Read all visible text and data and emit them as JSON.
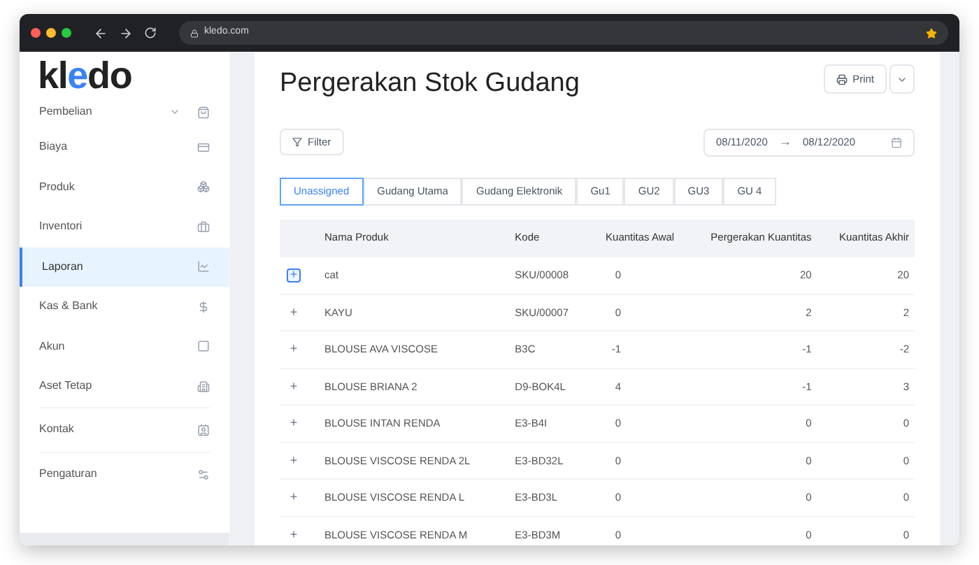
{
  "browser": {
    "url": "kledo.com"
  },
  "sidebar": {
    "logo": "kledo",
    "sections": [
      {
        "items": [
          {
            "label": "Pembelian",
            "selected": false,
            "expandable": true
          },
          {
            "label": "Biaya",
            "selected": false,
            "expandable": false
          },
          {
            "label": "Produk",
            "selected": false,
            "expandable": false
          },
          {
            "label": "Inventori",
            "selected": false,
            "expandable": false
          },
          {
            "label": "Laporan",
            "selected": true,
            "expandable": false
          },
          {
            "label": "Kas & Bank",
            "selected": false,
            "expandable": false
          },
          {
            "label": "Akun",
            "selected": false,
            "expandable": false
          },
          {
            "label": "Aset Tetap",
            "selected": false,
            "expandable": false
          }
        ]
      },
      {
        "items": [
          {
            "label": "Kontak",
            "selected": false,
            "expandable": false
          }
        ]
      },
      {
        "items": [
          {
            "label": "Pengaturan",
            "selected": false,
            "expandable": false
          }
        ]
      }
    ]
  },
  "page": {
    "title": "Pergerakan Stok Gudang",
    "print_button": "Print",
    "filter_button": "Filter",
    "date_from": "08/11/2020",
    "date_separator": "→",
    "date_to": "08/12/2020"
  },
  "tabs": [
    {
      "label": "Unassigned",
      "selected": true
    },
    {
      "label": "Gudang Utama",
      "selected": false
    },
    {
      "label": "Gudang Elektronik",
      "selected": false
    },
    {
      "label": "Gu1",
      "selected": false
    },
    {
      "label": "GU2",
      "selected": false
    },
    {
      "label": "GU3",
      "selected": false
    },
    {
      "label": "GU 4",
      "selected": false
    }
  ],
  "table": {
    "columns": [
      "Nama Produk",
      "Kode",
      "Kuantitas Awal",
      "Pergerakan Kuantitas",
      "Kuantitas Akhir"
    ],
    "rows": [
      {
        "expand": "+",
        "focused": true,
        "cells": [
          "cat",
          "SKU/00008",
          "0",
          "20",
          "20"
        ]
      },
      {
        "expand": "+",
        "focused": false,
        "cells": [
          "KAYU",
          "SKU/00007",
          "0",
          "2",
          "2"
        ]
      },
      {
        "expand": "+",
        "focused": false,
        "cells": [
          "BLOUSE AVA VISCOSE",
          "B3C",
          "-1",
          "-1",
          "-2"
        ]
      },
      {
        "expand": "+",
        "focused": false,
        "cells": [
          "BLOUSE BRIANA 2",
          "D9-BOK4L",
          "4",
          "-1",
          "3"
        ]
      },
      {
        "expand": "+",
        "focused": false,
        "cells": [
          "BLOUSE INTAN RENDA",
          "E3-B4I",
          "0",
          "0",
          "0"
        ]
      },
      {
        "expand": "+",
        "focused": false,
        "cells": [
          "BLOUSE VISCOSE RENDA 2L",
          "E3-BD32L",
          "0",
          "0",
          "0"
        ]
      },
      {
        "expand": "+",
        "focused": false,
        "cells": [
          "BLOUSE VISCOSE RENDA L",
          "E3-BD3L",
          "0",
          "0",
          "0"
        ]
      },
      {
        "expand": "+",
        "focused": false,
        "cells": [
          "BLOUSE VISCOSE RENDA M",
          "E3-BD3M",
          "0",
          "0",
          "0"
        ]
      }
    ]
  }
}
